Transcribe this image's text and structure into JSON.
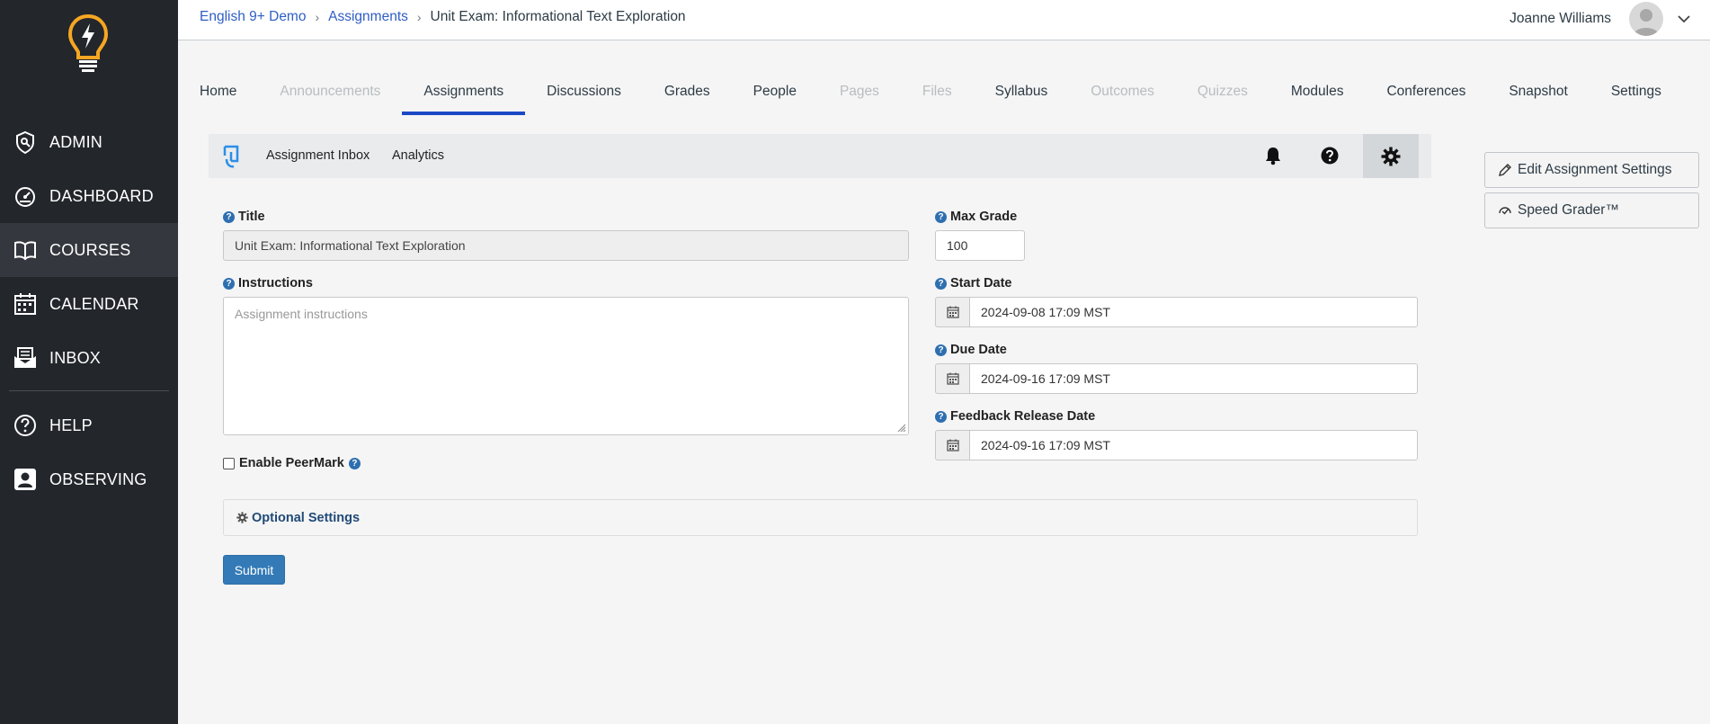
{
  "sidebar": {
    "items": [
      {
        "label": "ADMIN",
        "icon": "shield-icon",
        "active": false
      },
      {
        "label": "DASHBOARD",
        "icon": "speedometer-icon",
        "active": false
      },
      {
        "label": "COURSES",
        "icon": "book-icon",
        "active": true
      },
      {
        "label": "CALENDAR",
        "icon": "calendar-icon",
        "active": false
      },
      {
        "label": "INBOX",
        "icon": "inbox-icon",
        "active": false
      },
      {
        "label": "HELP",
        "icon": "help-circle-icon",
        "active": false
      },
      {
        "label": "OBSERVING",
        "icon": "user-badge-icon",
        "active": false
      }
    ]
  },
  "breadcrumb": {
    "course": "English 9+ Demo",
    "section": "Assignments",
    "current": "Unit Exam: Informational Text Exploration"
  },
  "user": {
    "name": "Joanne Williams"
  },
  "tabs": [
    {
      "label": "Home",
      "state": "normal"
    },
    {
      "label": "Announcements",
      "state": "disabled"
    },
    {
      "label": "Assignments",
      "state": "active"
    },
    {
      "label": "Discussions",
      "state": "normal"
    },
    {
      "label": "Grades",
      "state": "normal"
    },
    {
      "label": "People",
      "state": "normal"
    },
    {
      "label": "Pages",
      "state": "disabled"
    },
    {
      "label": "Files",
      "state": "disabled"
    },
    {
      "label": "Syllabus",
      "state": "normal"
    },
    {
      "label": "Outcomes",
      "state": "disabled"
    },
    {
      "label": "Quizzes",
      "state": "disabled"
    },
    {
      "label": "Modules",
      "state": "normal"
    },
    {
      "label": "Conferences",
      "state": "normal"
    },
    {
      "label": "Snapshot",
      "state": "normal"
    },
    {
      "label": "Settings",
      "state": "normal"
    }
  ],
  "toolbar": {
    "inbox_label": "Assignment Inbox",
    "analytics_label": "Analytics"
  },
  "side_buttons": {
    "edit_settings": "Edit Assignment Settings",
    "speed_grader": "Speed Grader™"
  },
  "form": {
    "title_label": "Title",
    "title_value": "Unit Exam: Informational Text Exploration",
    "instructions_label": "Instructions",
    "instructions_placeholder": "Assignment instructions",
    "max_grade_label": "Max Grade",
    "max_grade_value": "100",
    "start_date_label": "Start Date",
    "start_date_value": "2024-09-08 17:09 MST",
    "due_date_label": "Due Date",
    "due_date_value": "2024-09-16 17:09 MST",
    "feedback_date_label": "Feedback Release Date",
    "feedback_date_value": "2024-09-16 17:09 MST",
    "peermark_label": "Enable PeerMark",
    "optional_settings_label": "Optional Settings",
    "submit_label": "Submit"
  },
  "colors": {
    "sidebar_bg": "#23262b",
    "accent": "#1b49c6",
    "logo": "#f5a623",
    "primary_button": "#337ab7"
  }
}
